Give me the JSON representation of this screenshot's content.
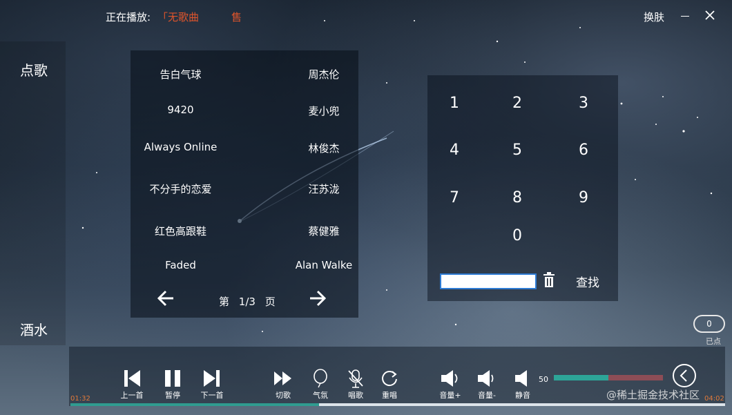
{
  "titlebar": {
    "now_playing_label": "正在播放:",
    "now_playing_song": "「无歌曲",
    "now_playing_extra": "售",
    "skin_label": "换肤"
  },
  "nav": {
    "song_label": "点歌",
    "drinks_label": "酒水"
  },
  "songs": [
    {
      "name": "告白气球",
      "artist": "周杰伦"
    },
    {
      "name": "9420",
      "artist": "麦小兜"
    },
    {
      "name": "Always Online",
      "artist": "林俊杰"
    },
    {
      "name": "不分手的恋爱",
      "artist": "汪苏泷"
    },
    {
      "name": "红色高跟鞋",
      "artist": "蔡健雅"
    },
    {
      "name": "Faded",
      "artist": "Alan Walke"
    }
  ],
  "pagination": {
    "prefix": "第",
    "value": "1/3",
    "suffix": "页",
    "current": 1,
    "total": 3
  },
  "keypad": {
    "keys": [
      "1",
      "2",
      "3",
      "4",
      "5",
      "6",
      "7",
      "8",
      "9",
      "0"
    ],
    "search_value": "",
    "find_label": "查找"
  },
  "ordered": {
    "count": "0",
    "label": "已点"
  },
  "controls": {
    "prev_label": "上一首",
    "pause_label": "暂停",
    "next_label": "下一首",
    "switch_label": "切歌",
    "ambience_label": "气氛",
    "sing_label": "唱歌",
    "replay_label": "重唱",
    "vol_up_label": "音量+",
    "vol_down_label": "音量-",
    "mute_label": "静音",
    "volume_value": "50",
    "volume_level": 0.5
  },
  "playback": {
    "current_time": "01:32",
    "total_time": "04:02",
    "progress": 0.38
  },
  "watermark": "@稀土掘金技术社区",
  "colors": {
    "accent_orange": "#e0552b",
    "teal": "#2da598",
    "volume_track": "#8d4d56",
    "input_border": "#2d7bd4"
  }
}
